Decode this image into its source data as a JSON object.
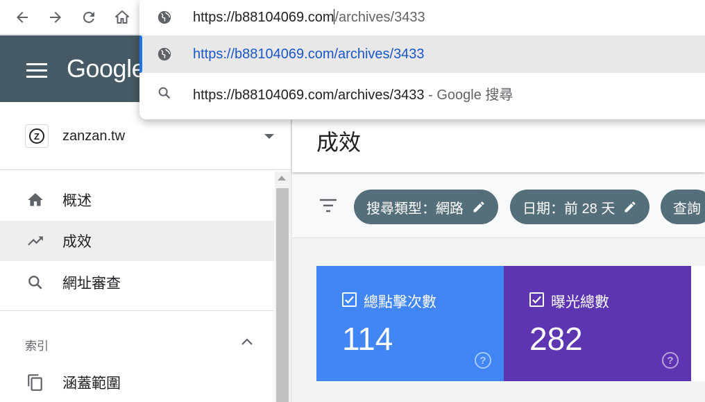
{
  "browser": {
    "back_icon": "arrow-left-icon",
    "forward_icon": "arrow-right-icon",
    "reload_icon": "reload-icon",
    "home_icon": "home-icon"
  },
  "omnibox": {
    "input_host": "https://b88104069.com",
    "input_path": "/archives/3433",
    "suggestions": [
      {
        "icon": "globe-icon",
        "text": "https://b88104069.com/archives/3433",
        "suffix": ""
      },
      {
        "icon": "search-icon",
        "text": "https://b88104069.com/archives/3433",
        "suffix": " - Google 搜尋"
      }
    ],
    "accent_color": "#1a73e8"
  },
  "app": {
    "brand": "Google",
    "header_color": "#455a64"
  },
  "sidebar": {
    "property_name": "zanzan.tw",
    "property_logo": "Z",
    "items": [
      {
        "label": "概述",
        "icon": "home-icon"
      },
      {
        "label": "成效",
        "icon": "trending-up-icon",
        "active": true
      },
      {
        "label": "網址審查",
        "icon": "search-icon"
      }
    ],
    "section_label": "索引",
    "section_items": [
      {
        "label": "涵蓋範圍",
        "icon": "copy-icon"
      }
    ]
  },
  "main": {
    "title": "成效",
    "filters": [
      {
        "label": "搜尋類型：網路"
      },
      {
        "label": "日期：前 28 天"
      },
      {
        "label": "查詢"
      }
    ],
    "metrics": [
      {
        "label": "總點擊次數",
        "value": "114",
        "checked": true,
        "color": "#4285f4"
      },
      {
        "label": "曝光總數",
        "value": "282",
        "checked": true,
        "color": "#5e35b1"
      }
    ]
  }
}
